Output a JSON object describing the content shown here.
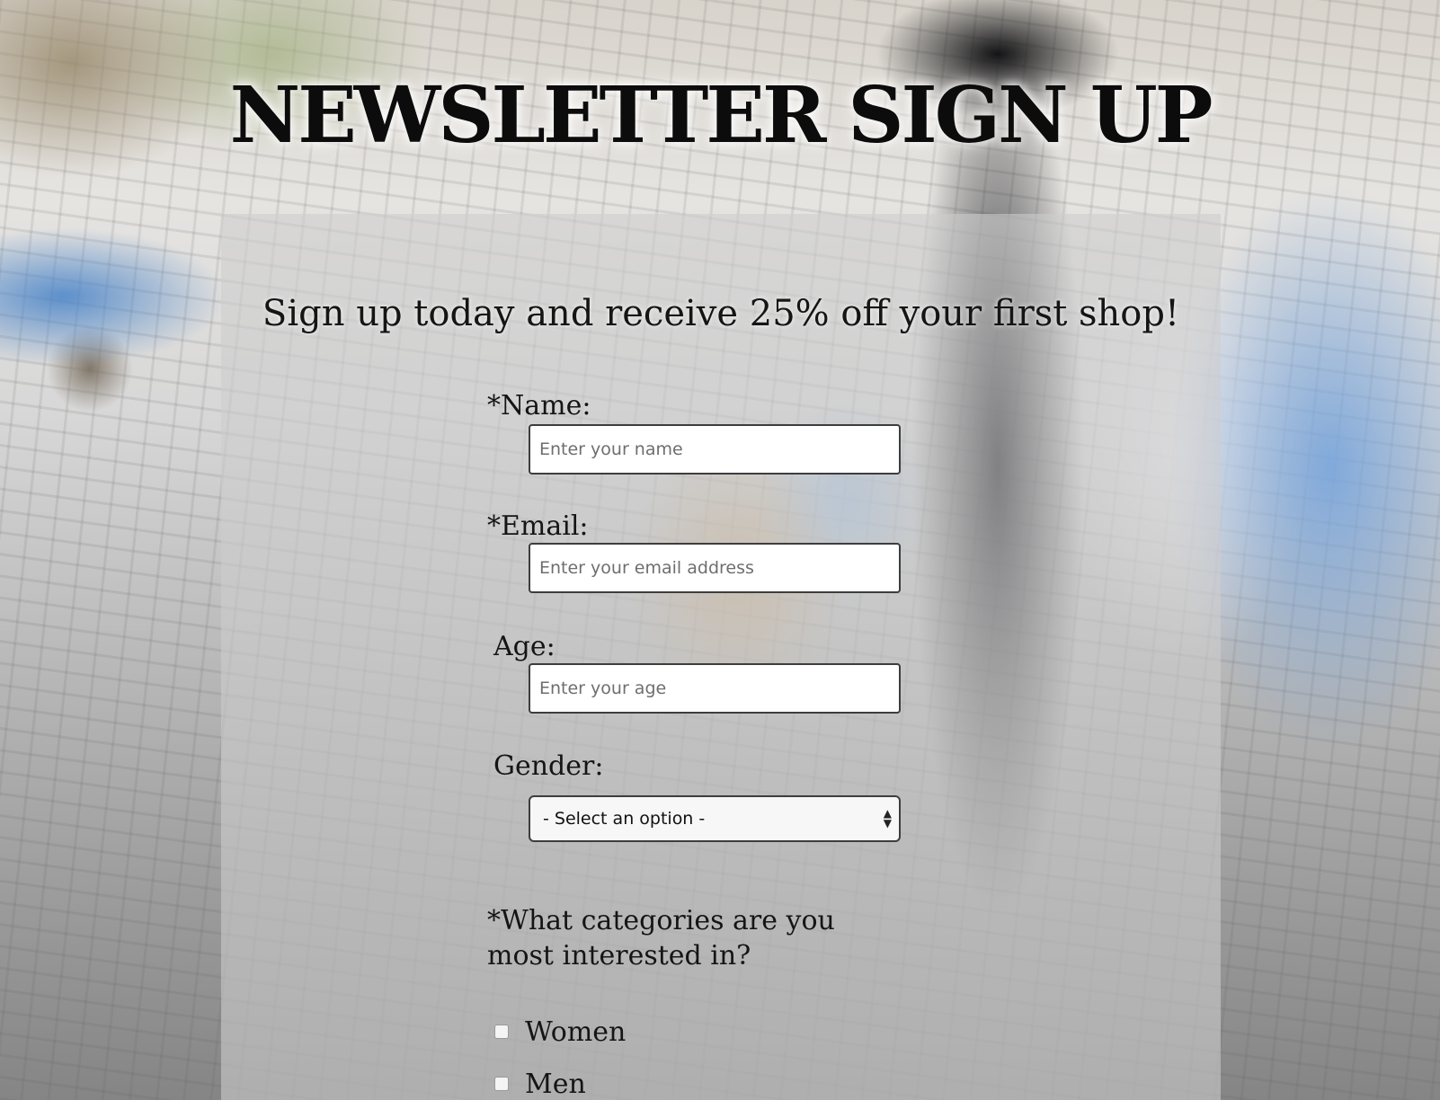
{
  "header": {
    "title": "NEWSLETTER SIGN UP"
  },
  "form": {
    "subtitle": "Sign up today and receive 25% off your first shop!",
    "name_label": "*Name:",
    "name_placeholder": "Enter your name",
    "email_label": "*Email:",
    "email_placeholder": "Enter your email address",
    "age_label": "Age:",
    "age_placeholder": "Enter your age",
    "gender_label": "Gender:",
    "gender_selected": "- Select an option -",
    "categories_question": "*What categories are you most interested in?",
    "categories": [
      {
        "label": "Women",
        "checked": false
      },
      {
        "label": "Men",
        "checked": false
      }
    ]
  }
}
